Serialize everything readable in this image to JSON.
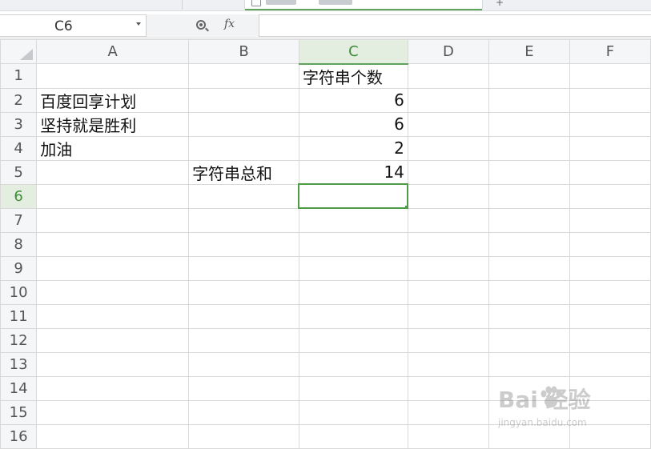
{
  "formula_bar": {
    "name_box": "C6",
    "fx_label": "fx",
    "formula": ""
  },
  "columns": [
    "A",
    "B",
    "C",
    "D",
    "E",
    "F"
  ],
  "active_cell": {
    "col": "C",
    "row": 6
  },
  "rows": [
    {
      "num": "1",
      "cells": [
        "",
        "",
        "字符串个数",
        "",
        "",
        ""
      ]
    },
    {
      "num": "2",
      "cells": [
        "百度回享计划",
        "",
        "6",
        "",
        "",
        ""
      ]
    },
    {
      "num": "3",
      "cells": [
        "坚持就是胜利",
        "",
        "6",
        "",
        "",
        ""
      ]
    },
    {
      "num": "4",
      "cells": [
        "加油",
        "",
        "2",
        "",
        "",
        ""
      ]
    },
    {
      "num": "5",
      "cells": [
        "",
        "字符串总和",
        "14",
        "",
        "",
        ""
      ]
    },
    {
      "num": "6",
      "cells": [
        "",
        "",
        "",
        "",
        "",
        ""
      ]
    },
    {
      "num": "7",
      "cells": [
        "",
        "",
        "",
        "",
        "",
        ""
      ]
    },
    {
      "num": "8",
      "cells": [
        "",
        "",
        "",
        "",
        "",
        ""
      ]
    },
    {
      "num": "9",
      "cells": [
        "",
        "",
        "",
        "",
        "",
        ""
      ]
    },
    {
      "num": "10",
      "cells": [
        "",
        "",
        "",
        "",
        "",
        ""
      ]
    },
    {
      "num": "11",
      "cells": [
        "",
        "",
        "",
        "",
        "",
        ""
      ]
    },
    {
      "num": "12",
      "cells": [
        "",
        "",
        "",
        "",
        "",
        ""
      ]
    },
    {
      "num": "13",
      "cells": [
        "",
        "",
        "",
        "",
        "",
        ""
      ]
    },
    {
      "num": "14",
      "cells": [
        "",
        "",
        "",
        "",
        "",
        ""
      ]
    },
    {
      "num": "15",
      "cells": [
        "",
        "",
        "",
        "",
        "",
        ""
      ]
    },
    {
      "num": "16",
      "cells": [
        "",
        "",
        "",
        "",
        "",
        ""
      ]
    }
  ],
  "watermark": {
    "brand": "Bai  经验",
    "sub": "jingyan.baidu.com"
  },
  "colors": {
    "accent": "#4f9b48",
    "header_bg": "#f5f6f7",
    "gridline": "#d9d9d9"
  },
  "icons": {
    "zoom": "zoom-icon",
    "dropdown": "chevron-down-icon",
    "sheet_corner": "select-all-icon"
  }
}
